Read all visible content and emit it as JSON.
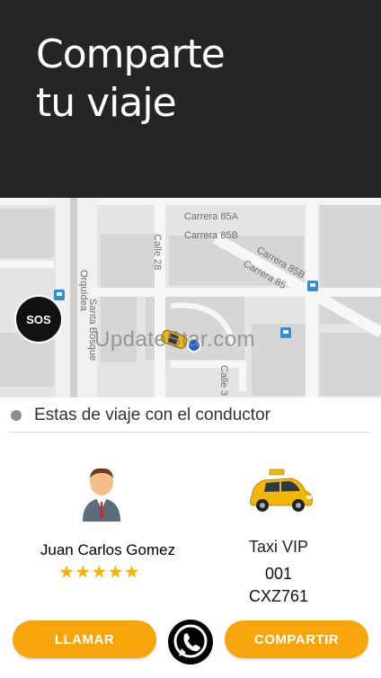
{
  "header": {
    "title_line1": "Comparte",
    "title_line2": "tu viaje"
  },
  "map": {
    "streets": [
      "Carrera 85A",
      "Carrera 85B",
      "Calle 28",
      "Carrera 85B",
      "Carrera 85",
      "Santa Bosque",
      "Calle 3",
      "Orquídea"
    ],
    "sos_label": "SOS",
    "watermark": "UpdateStar.com"
  },
  "trip": {
    "status_text": "Estas de viaje con el conductor"
  },
  "driver": {
    "name": "Juan Carlos Gomez",
    "rating": 5,
    "rating_max": 5
  },
  "vehicle": {
    "type": "Taxi VIP",
    "number": "001",
    "plate": "CXZ761"
  },
  "actions": {
    "call_label": "LLAMAR",
    "share_label": "COMPARTIR"
  },
  "icons": [
    "sos-icon",
    "whatsapp-icon",
    "driver-avatar-icon",
    "taxi-car-icon",
    "star-icon",
    "bus-stop-icon"
  ],
  "colors": {
    "accent": "#f7a50b",
    "header_bg": "#252525",
    "star": "#f5b400",
    "taxi": "#f2b705"
  }
}
